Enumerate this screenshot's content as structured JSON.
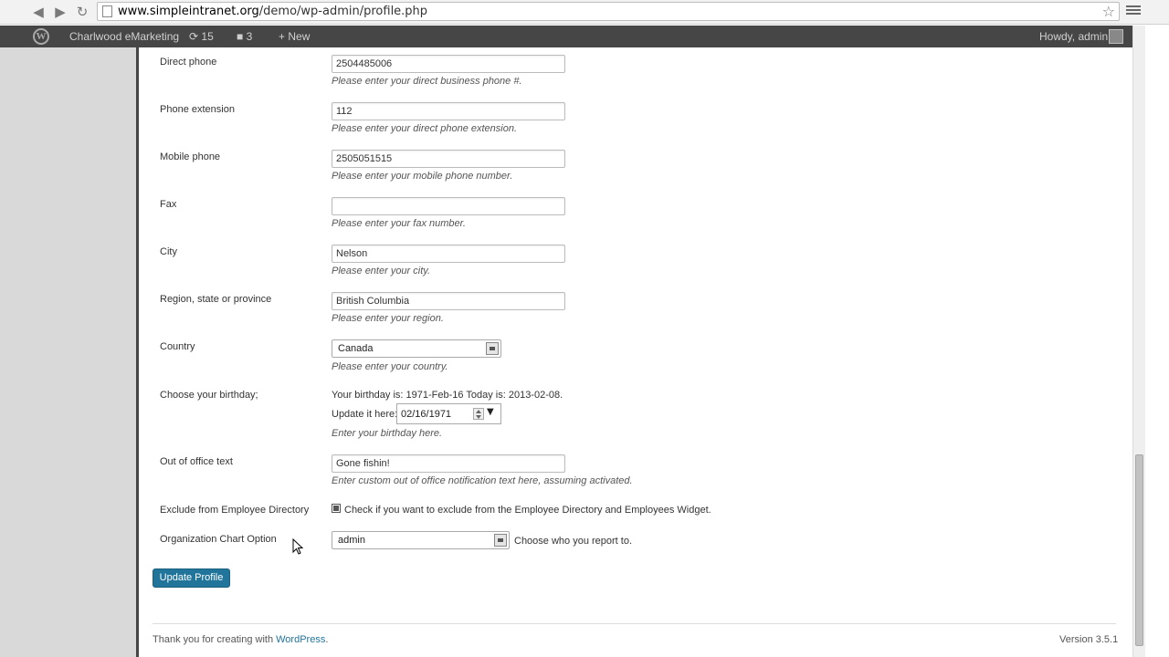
{
  "browser": {
    "back_icon": "arrow-left-icon",
    "forward_icon": "arrow-right-icon",
    "reload_icon": "reload-icon",
    "url_host": "www.simpleintranet.org",
    "url_path": "/demo/wp-admin/profile.php",
    "star_icon": "star-icon",
    "menu_icon": "menu-icon"
  },
  "adminbar": {
    "site_name": "Charlwood eMarketing",
    "updates_count": "15",
    "comments_count": "3",
    "new_label": "New",
    "howdy": "Howdy, admin"
  },
  "form": {
    "direct_phone": {
      "label": "Direct phone",
      "value": "2504485006",
      "description": "Please enter your direct business phone #."
    },
    "phone_extension": {
      "label": "Phone extension",
      "value": "112",
      "description": "Please enter your direct phone extension."
    },
    "mobile_phone": {
      "label": "Mobile phone",
      "value": "2505051515",
      "description": "Please enter your mobile phone number."
    },
    "fax": {
      "label": "Fax",
      "value": "",
      "description": "Please enter your fax number."
    },
    "city": {
      "label": "City",
      "value": "Nelson",
      "description": "Please enter your city."
    },
    "region": {
      "label": "Region, state or province",
      "value": "British Columbia",
      "description": "Please enter your region."
    },
    "country": {
      "label": "Country",
      "value": "Canada",
      "description": "Please enter your country."
    },
    "birthday": {
      "label": "Choose your birthday;",
      "info": "Your birthday is: 1971-Feb-16 Today is: 2013-02-08.",
      "update_label": "Update it here:",
      "value": "02/16/1971",
      "description": "Enter your birthday here."
    },
    "out_of_office": {
      "label": "Out of office text",
      "value": "Gone fishin!",
      "description": "Enter custom out of office notification text here, assuming activated."
    },
    "exclude_directory": {
      "label": "Exclude from Employee Directory",
      "checked": true,
      "text": "Check if you want to exclude from the Employee Directory and Employees Widget."
    },
    "org_chart": {
      "label": "Organization Chart Option",
      "value": "admin",
      "text": "Choose who you report to."
    },
    "submit_label": "Update Profile"
  },
  "footer": {
    "thanks_prefix": "Thank you for creating with ",
    "wordpress_link": "WordPress",
    "thanks_suffix": ".",
    "version": "Version 3.5.1"
  },
  "colors": {
    "accent": "#21759b",
    "adminbar": "#464646",
    "sidebar": "#d9d9d9"
  }
}
